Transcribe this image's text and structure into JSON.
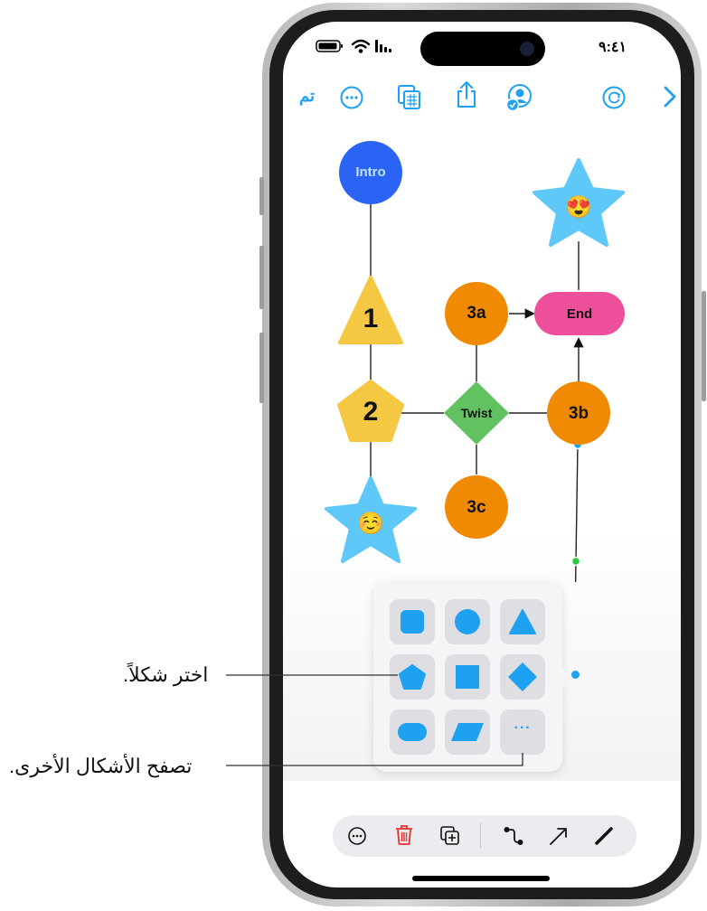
{
  "status_bar": {
    "time": "٩:٤١"
  },
  "toolbar": {
    "done_label": "تم",
    "more_icon": "ellipsis-circle-icon",
    "copy_icon": "copy-pages-icon",
    "share_icon": "share-icon",
    "collaborate_icon": "collaborate-icon",
    "refresh_icon": "refresh-icon",
    "next_icon": "chevron-right-icon"
  },
  "diagram": {
    "nodes": {
      "intro": "Intro",
      "one": "1",
      "two": "2",
      "n3a": "3a",
      "end": "End",
      "twist": "Twist",
      "n3b": "3b",
      "n3c": "3c",
      "star_top_emoji": "😍",
      "star_bottom_emoji": "☺️"
    },
    "colors": {
      "intro": "#2b63f4",
      "yellow": "#f5c843",
      "orange": "#ef8a02",
      "pink": "#ee4f9b",
      "green": "#62c262",
      "star": "#5ec8f8",
      "accent": "#1ea1f1"
    }
  },
  "shapes_panel": {
    "shapes": [
      "rounded-square",
      "circle",
      "triangle",
      "pentagon",
      "square",
      "diamond",
      "capsule",
      "parallelogram",
      "more"
    ],
    "more_label": "···"
  },
  "bottom_toolbar": {
    "items": [
      "more-icon",
      "delete-icon",
      "duplicate-icon",
      "connector-icon",
      "arrow-icon",
      "line-icon"
    ]
  },
  "callouts": {
    "choose_shape": "اختر شكلاً.",
    "browse_shapes": "تصفح الأشكال الأخرى."
  }
}
